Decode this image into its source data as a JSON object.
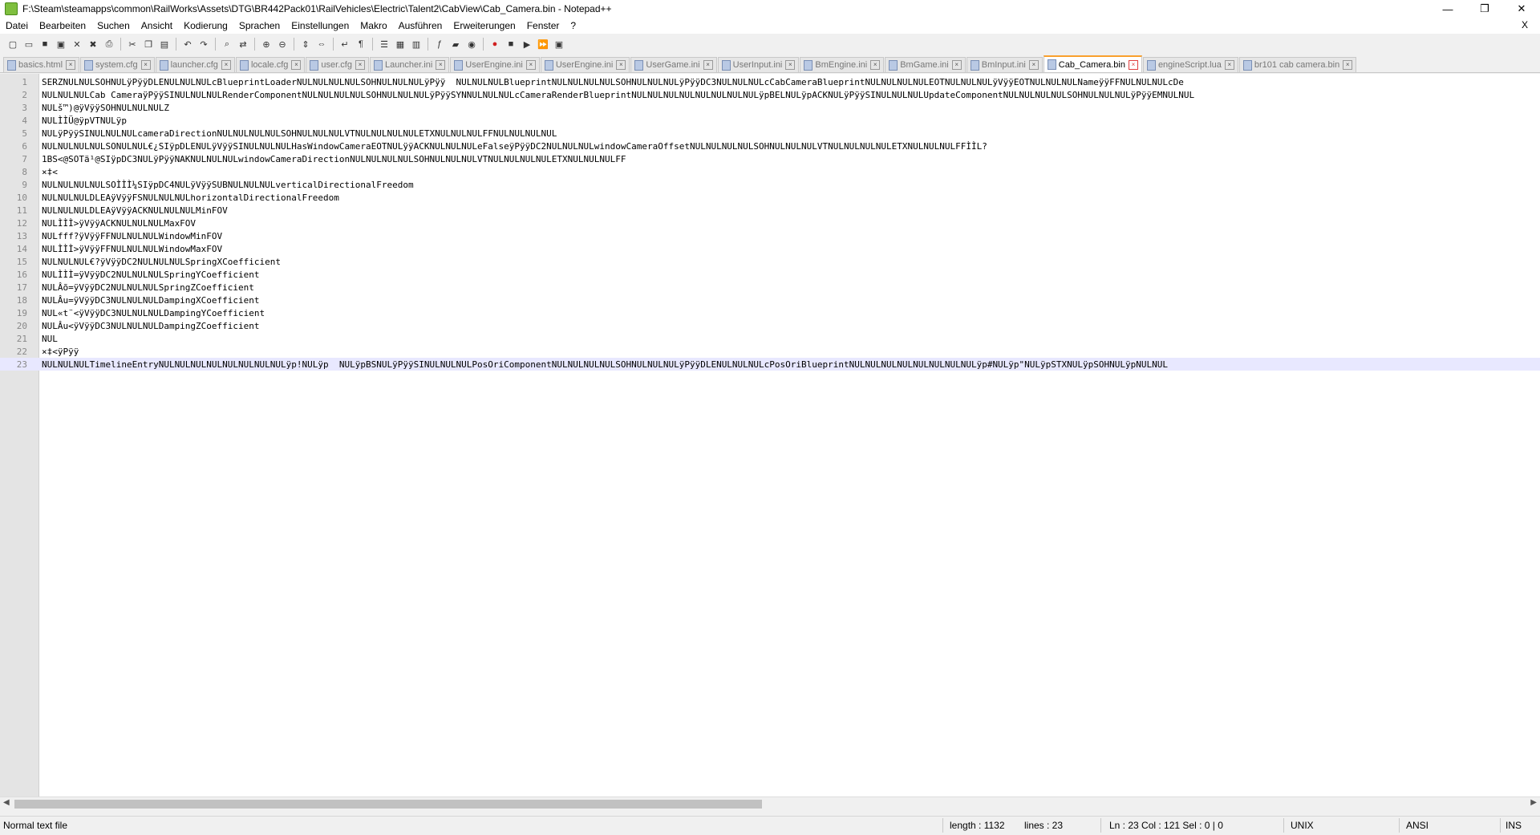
{
  "window": {
    "title": "F:\\Steam\\steamapps\\common\\RailWorks\\Assets\\DTG\\BR442Pack01\\RailVehicles\\Electric\\Talent2\\CabView\\Cab_Camera.bin - Notepad++",
    "minimize": "—",
    "maximize": "❐",
    "close": "✕"
  },
  "menu": {
    "items": [
      "Datei",
      "Bearbeiten",
      "Suchen",
      "Ansicht",
      "Kodierung",
      "Sprachen",
      "Einstellungen",
      "Makro",
      "Ausführen",
      "Erweiterungen",
      "Fenster",
      "?"
    ],
    "close_doc": "X"
  },
  "toolbar": {
    "icons": [
      "new-icon",
      "open-icon",
      "save-icon",
      "save-all-icon",
      "close-icon",
      "close-all-icon",
      "print-icon",
      "cut-icon",
      "copy-icon",
      "paste-icon",
      "undo-icon",
      "redo-icon",
      "find-icon",
      "replace-icon",
      "zoom-in-icon",
      "zoom-out-icon",
      "sync-v-icon",
      "sync-h-icon",
      "word-wrap-icon",
      "show-all-chars-icon",
      "indent-guide-icon",
      "udl-icon",
      "doc-map-icon",
      "function-list-icon",
      "folder-workspace-icon",
      "monitoring-icon",
      "record-icon",
      "stop-icon",
      "play-icon",
      "play-multi-icon",
      "save-macro-icon"
    ]
  },
  "tabs": [
    {
      "label": "basics.html",
      "active": false
    },
    {
      "label": "system.cfg",
      "active": false
    },
    {
      "label": "launcher.cfg",
      "active": false
    },
    {
      "label": "locale.cfg",
      "active": false
    },
    {
      "label": "user.cfg",
      "active": false
    },
    {
      "label": "Launcher.ini",
      "active": false
    },
    {
      "label": "UserEngine.ini",
      "active": false
    },
    {
      "label": "UserEngine.ini",
      "active": false
    },
    {
      "label": "UserGame.ini",
      "active": false
    },
    {
      "label": "UserInput.ini",
      "active": false
    },
    {
      "label": "BmEngine.ini",
      "active": false
    },
    {
      "label": "BmGame.ini",
      "active": false
    },
    {
      "label": "BmInput.ini",
      "active": false
    },
    {
      "label": "Cab_Camera.bin",
      "active": true
    },
    {
      "label": "engineScript.lua",
      "active": false
    },
    {
      "label": "br101 cab camera.bin",
      "active": false
    }
  ],
  "editor": {
    "lines": [
      {
        "n": "1",
        "text": "SERZNULNULSOHNULÿPÿÿDLENULNULNULcBlueprintLoaderNULNULNULNULSOHNULNULNULÿPÿÿ  NULNULNULBlueprintNULNULNULNULSOHNULNULNULÿPÿÿDC3NULNULNULcCabCameraBlueprintNULNULNULNULEOTNULNULNULÿVÿÿEOTNULNULNULNameÿÿFFNULNULNULcDe"
      },
      {
        "n": "2",
        "text": "NULNULNULCab CameraÿPÿÿSINULNULNULRenderComponentNULNULNULNULSOHNULNULNULÿPÿÿSYNNULNULNULcCameraRenderBlueprintNULNULNULNULNULNULNULNULÿpBELNULÿpACKNULÿPÿÿSINULNULNULUpdateComponentNULNULNULNULSOHNULNULNULÿPÿÿEMNULNUL"
      },
      {
        "n": "3",
        "text": "NULš™)@ÿVÿÿSOHNULNULNULZ"
      },
      {
        "n": "4",
        "text": "NULÌÌÜ@ÿpVTNULÿp"
      },
      {
        "n": "5",
        "text": "NULÿPÿÿSINULNULNULcameraDirectionNULNULNULNULSOHNULNULNULVTNULNULNULNULETXNULNULNULFFNULNULNULNUL"
      },
      {
        "n": "6",
        "text": "NULNULNULNULSONULNUL€¿SIÿpDLENULÿVÿÿSINULNULNULHasWindowCameraEOTNULÿÿACKNULNULNULeFalseÿPÿÿDC2NULNULNULwindowCameraOffsetNULNULNULNULSOHNULNULNULVTNULNULNULNULETXNULNULNULFFÌÌL?"
      },
      {
        "n": "7",
        "text": "1BS<@SOTä¹@SIÿpDC3NULÿPÿÿNAKNULNULNULwindowCameraDirectionNULNULNULNULSOHNULNULNULVTNULNULNULNULETXNULNULNULFF"
      },
      {
        "n": "8",
        "text": "×‡<"
      },
      {
        "n": "9",
        "text": "NULNULNULNULSOÌÌÌ¼SIÿpDC4NULÿVÿÿSUBNULNULNULverticalDirectionalFreedom"
      },
      {
        "n": "10",
        "text": "NULNULNULDLEAÿVÿÿFSNULNULNULhorizontalDirectionalFreedom"
      },
      {
        "n": "11",
        "text": "NULNULNULDLEAÿVÿÿACKNULNULNULMinFOV"
      },
      {
        "n": "12",
        "text": "NULÌÌÌ>ÿVÿÿACKNULNULNULMaxFOV"
      },
      {
        "n": "13",
        "text": "NULfff?ÿVÿÿFFNULNULNULWindowMinFOV"
      },
      {
        "n": "14",
        "text": "NULÌÌÌ>ÿVÿÿFFNULNULNULWindowMaxFOV"
      },
      {
        "n": "15",
        "text": "NULNULNUL€?ÿVÿÿDC2NULNULNULSpringXCoefficient"
      },
      {
        "n": "16",
        "text": "NULÌÌÌ=ÿVÿÿDC2NULNULNULSpringYCoefficient"
      },
      {
        "n": "17",
        "text": "NULÂõ=ÿVÿÿDC2NULNULNULSpringZCoefficient"
      },
      {
        "n": "18",
        "text": "NULÂu=ÿVÿÿDC3NULNULNULDampingXCoefficient"
      },
      {
        "n": "19",
        "text": "NUL«t¨<ÿVÿÿDC3NULNULNULDampingYCoefficient"
      },
      {
        "n": "20",
        "text": "NULÂu<ÿVÿÿDC3NULNULNULDampingZCoefficient"
      },
      {
        "n": "21",
        "text": "NUL"
      },
      {
        "n": "22",
        "text": "×‡<ÿPÿÿ"
      },
      {
        "n": "23",
        "text": "NULNULNULTimelineEntryNULNULNULNULNULNULNULNULÿp!NULÿp  NULÿpBSNULÿPÿÿSINULNULNULPosOriComponentNULNULNULNULSOHNULNULNULÿPÿÿDLENULNULNULcPosOriBlueprintNULNULNULNULNULNULNULNULÿp#NULÿp\"NULÿpSTXNULÿpSOHNULÿpNULNUL"
      }
    ]
  },
  "status": {
    "file_type": "Normal text file",
    "length": "length : 1132",
    "lines": "lines : 23",
    "position": "Ln : 23    Col : 121    Sel : 0 | 0",
    "eol": "UNIX",
    "encoding": "ANSI",
    "mode": "INS"
  },
  "colors": {
    "active_tab_accent": "#f9a02d",
    "current_line": "#e8e8ff",
    "gutter": "#e4e4e4"
  }
}
